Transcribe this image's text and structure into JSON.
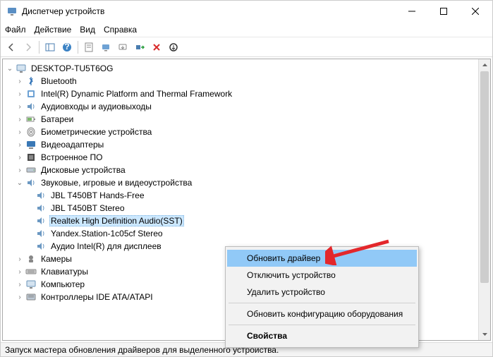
{
  "titlebar": {
    "title": "Диспетчер устройств"
  },
  "menu": {
    "file": "Файл",
    "action": "Действие",
    "view": "Вид",
    "help": "Справка"
  },
  "tree": {
    "root": "DESKTOP-TU5T6OG",
    "items": [
      "Bluetooth",
      "Intel(R) Dynamic Platform and Thermal Framework",
      "Аудиовходы и аудиовыходы",
      "Батареи",
      "Биометрические устройства",
      "Видеоадаптеры",
      "Встроенное ПО",
      "Дисковые устройства"
    ],
    "sound_label": "Звуковые, игровые и видеоустройства",
    "sound_children": [
      "JBL T450BT Hands-Free",
      "JBL T450BT Stereo",
      "Realtek High Definition Audio(SST)",
      "Yandex.Station-1c05cf Stereo",
      "Аудио Intel(R) для дисплеев"
    ],
    "after": [
      "Камеры",
      "Клавиатуры",
      "Компьютер",
      "Контроллеры IDE ATA/ATAPI"
    ]
  },
  "ctx": {
    "update": "Обновить драйвер",
    "disable": "Отключить устройство",
    "uninstall": "Удалить устройство",
    "scan": "Обновить конфигурацию оборудования",
    "props": "Свойства"
  },
  "status": "Запуск мастера обновления драйверов для выделенного устройства."
}
